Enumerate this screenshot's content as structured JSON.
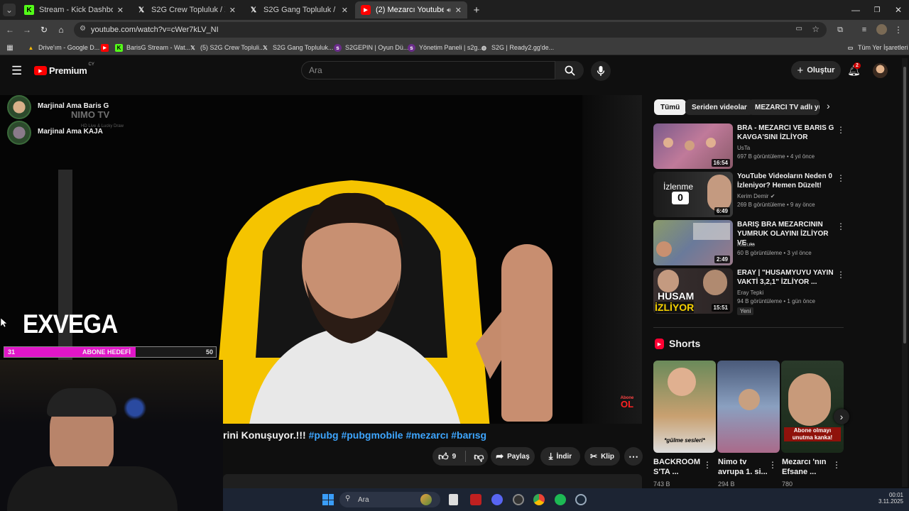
{
  "browser": {
    "tabs": [
      {
        "label": "Stream - Kick Dashboard",
        "icon": "kick-icon",
        "active": false
      },
      {
        "label": "S2G Crew Topluluk / X",
        "icon": "x-icon",
        "active": false
      },
      {
        "label": "S2G Gang Topluluk / X",
        "icon": "x-icon",
        "active": false
      },
      {
        "label": "(2) Mezarcı Youtuberlar Hal",
        "icon": "youtube-icon",
        "active": true
      }
    ],
    "url": "youtube.com/watch?v=cWer7kLV_NI",
    "bookmarks": [
      {
        "label": "Drive'ım - Google D...",
        "icon": "google-drive-icon"
      },
      {
        "label": "",
        "icon": "youtube-icon"
      },
      {
        "label": "BarisG Stream - Wat...",
        "icon": "kick-icon"
      },
      {
        "label": "(5) S2G Crew Topluli...",
        "icon": "x-icon"
      },
      {
        "label": "S2G Gang Topluluk...",
        "icon": "x-icon"
      },
      {
        "label": "S2GEPIN | Oyun Dü...",
        "icon": "s2g-icon"
      },
      {
        "label": "Yönetim Paneli | s2g...",
        "icon": "s2g-icon"
      },
      {
        "label": "S2G | Ready2.gg'de...",
        "icon": "globe-icon"
      }
    ],
    "all_bookmarks": "Tüm Yer İşaretleri"
  },
  "youtube": {
    "logo": "Premium",
    "logo_region": "CY",
    "search_placeholder": "Ara",
    "create_label": "Oluştur",
    "notif_count": "2"
  },
  "player": {
    "overlay_users": [
      "Marjinal Ama Baris G",
      "Marjinal Ama KAJA"
    ],
    "nimo_text": "NIMO TV",
    "nimo_sub": "HD Live & Lucky Draw",
    "brand_text": "EXVEGA",
    "goal": {
      "current": "31",
      "label": "ABONE HEDEFİ",
      "target": "50",
      "progress": 0.62
    },
    "corner_badge_top": "Abone",
    "corner_badge_bottom": "OL"
  },
  "video": {
    "title_fragment": "rini Konuşuyor.!!! ",
    "hashtags": "#pubg #pubgmobile #mezarcı #barısg",
    "likes": "9",
    "share_label": "Paylaş",
    "download_label": "İndir",
    "clip_label": "Klip"
  },
  "chips": [
    "Tümü",
    "Seriden videolar",
    "MEZARCI TV adlı yük"
  ],
  "related": [
    {
      "title": "BRA - MEZARCI VE BARIS G KAVGA'SINI İZLİYOR",
      "channel": "UsTa",
      "meta": "697 B görüntüleme • 4 yıl önce",
      "duration": "16:54",
      "badge": ""
    },
    {
      "title": "YouTube Videoların Neden 0 İzleniyor? Hemen Düzelt!",
      "channel": "Kerim Demir",
      "meta": "269 B görüntüleme • 9 ay önce",
      "duration": "6:49",
      "badge": "",
      "thumb_text": "İzlenme",
      "thumb_num": "0"
    },
    {
      "title": "BARIŞ BRA MEZARCININ YUMRUK OLAYINI İZLİYOR VE ...",
      "channel": "Kazuto",
      "meta": "60 B görüntüleme • 3 yıl önce",
      "duration": "2:49",
      "badge": ""
    },
    {
      "title": "ERAY | \"HUSAMYUYU YAYIN VAKTİ 3,2,1\" İZLİYOR ...",
      "channel": "Eray Tepki",
      "meta": "94 B görüntüleme • 1 gün önce",
      "duration": "15:51",
      "badge": "Yeni",
      "thumb_text": "HUSAM",
      "thumb_sub": "İZLİYOR"
    }
  ],
  "shorts_label": "Shorts",
  "shorts": [
    {
      "title": "BACKROOM S'TA ...",
      "views": "743 B",
      "caption": "*gülme sesleri*"
    },
    {
      "title": "Nimo tv avrupa 1. si...",
      "views": "294 B",
      "caption": ""
    },
    {
      "title": "Mezarcı 'nın Efsane ...",
      "views": "780",
      "caption": "Abone olmayı unutma kanka!"
    }
  ],
  "taskbar": {
    "search": "Ara",
    "time": "00:01",
    "date": "3.11.2025"
  }
}
